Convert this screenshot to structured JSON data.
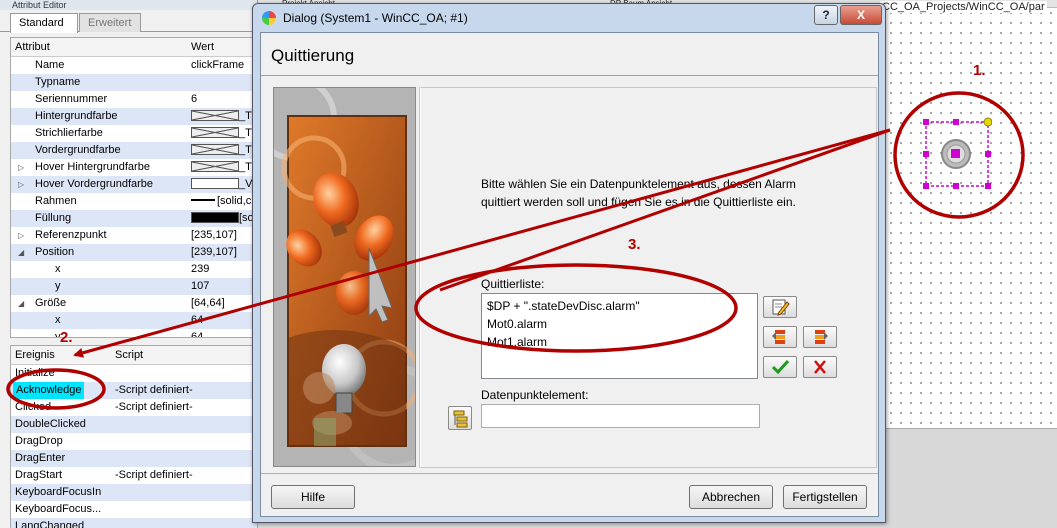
{
  "attr_editor": {
    "title": "Attribut Editor",
    "tabs": [
      "Standard",
      "Erweitert"
    ],
    "headers": {
      "name": "Attribut",
      "value": "Wert"
    },
    "rows": [
      {
        "name": "Name",
        "value": "clickFrame",
        "indent": 1
      },
      {
        "name": "Typname",
        "value": "",
        "indent": 1
      },
      {
        "name": "Seriennummer",
        "value": "6",
        "indent": 1
      },
      {
        "name": "Hintergrundfarbe",
        "value": "_T",
        "swatch": "x",
        "indent": 1
      },
      {
        "name": "Strichlierfarbe",
        "value": "_T",
        "swatch": "x",
        "indent": 1
      },
      {
        "name": "Vordergrundfarbe",
        "value": "_T",
        "swatch": "x",
        "indent": 1
      },
      {
        "name": "Hover Hintergrundfarbe",
        "value": "_T",
        "swatch": "x",
        "indent": 1,
        "expand": "right"
      },
      {
        "name": "Hover Vordergrundfarbe",
        "value": "_V",
        "swatch": "white",
        "indent": 1,
        "expand": "right"
      },
      {
        "name": "Rahmen",
        "value": "[solid,c",
        "swatch": "line",
        "indent": 1
      },
      {
        "name": "Füllung",
        "value": "[solid]",
        "swatch": "black",
        "indent": 1
      },
      {
        "name": "Referenzpunkt",
        "value": "[235,107]",
        "indent": 1,
        "expand": "right"
      },
      {
        "name": "Position",
        "value": "[239,107]",
        "indent": 1,
        "expand": "down"
      },
      {
        "name": "x",
        "value": "239",
        "indent": 2
      },
      {
        "name": "y",
        "value": "107",
        "indent": 2
      },
      {
        "name": "Größe",
        "value": "[64,64]",
        "indent": 1,
        "expand": "down"
      },
      {
        "name": "x",
        "value": "64",
        "indent": 2
      },
      {
        "name": "y",
        "value": "64",
        "indent": 2
      }
    ],
    "event_headers": {
      "name": "Ereignis",
      "script": "Script"
    },
    "events": [
      {
        "name": "Initialize",
        "script": ""
      },
      {
        "name": "Acknowledge",
        "script": "-Script definiert-",
        "selected": true
      },
      {
        "name": "Clicked",
        "script": "-Script definiert-"
      },
      {
        "name": "DoubleClicked",
        "script": ""
      },
      {
        "name": "DragDrop",
        "script": ""
      },
      {
        "name": "DragEnter",
        "script": ""
      },
      {
        "name": "DragStart",
        "script": "-Script definiert-"
      },
      {
        "name": "KeyboardFocusIn",
        "script": ""
      },
      {
        "name": "KeyboardFocus...",
        "script": ""
      },
      {
        "name": "LangChanged",
        "script": ""
      }
    ]
  },
  "background": {
    "strip_label_1": "Projekt Ansicht",
    "strip_label_2": "DP Baum Ansicht",
    "path": "CC_OA_Projects/WinCC_OA/par"
  },
  "dialog": {
    "title": "Dialog (System1 - WinCC_OA; #1)",
    "help_glyph": "?",
    "close_glyph": "X",
    "header": "Quittierung",
    "description": "Bitte wählen Sie ein Datenpunktelement aus, dessen Alarm quittiert werden soll und fügen Sie es in die Quittierliste ein.",
    "list_label": "Quittierliste:",
    "list_items": [
      "$DP + \".stateDevDisc.alarm\"",
      "Mot0.alarm",
      "Mot1.alarm"
    ],
    "dpe_label": "Datenpunktelement:",
    "dpe_value": "",
    "buttons": {
      "help": "Hilfe",
      "cancel": "Abbrechen",
      "finish": "Fertigstellen"
    }
  },
  "annotations": [
    "1.",
    "2.",
    "3."
  ],
  "colors": {
    "annotation": "#b00000",
    "selection": "#00e5ff",
    "row_alt": "#dde6f7"
  }
}
